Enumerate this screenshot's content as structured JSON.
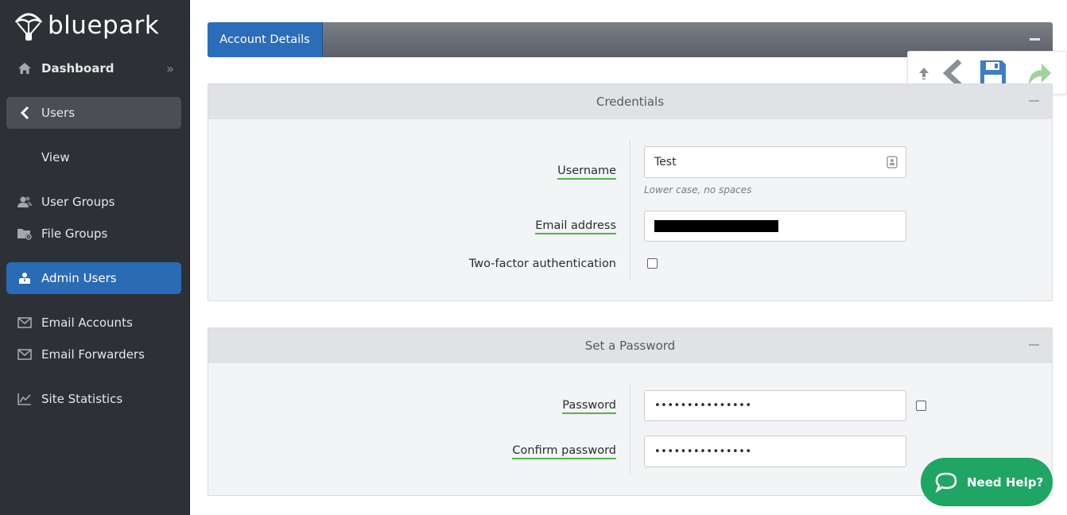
{
  "brand": {
    "name": "bluepark"
  },
  "sidebar": {
    "items": [
      {
        "label": "Dashboard",
        "icon": "home-icon"
      },
      {
        "label": "Users",
        "icon": "chevron-left-icon"
      },
      {
        "label": "View",
        "icon": ""
      },
      {
        "label": "User Groups",
        "icon": "user-group-icon"
      },
      {
        "label": "File Groups",
        "icon": "folder-settings-icon"
      },
      {
        "label": "Admin Users",
        "icon": "admin-user-icon"
      },
      {
        "label": "Email Accounts",
        "icon": "envelope-icon"
      },
      {
        "label": "Email Forwarders",
        "icon": "envelope-icon"
      },
      {
        "label": "Site Statistics",
        "icon": "line-chart-icon"
      }
    ],
    "dashboard_chevron": "››"
  },
  "tabs": [
    {
      "label": "Account Details",
      "active": true
    }
  ],
  "toolbar": {
    "buttons": [
      "upload-icon",
      "back-icon",
      "save-icon",
      "forward-icon"
    ],
    "colors": {
      "save": "#3d7ec7",
      "forward": "#9fd39c",
      "back": "#8b9096"
    }
  },
  "credentials": {
    "title": "Credentials",
    "username_label": "Username",
    "username_value": "Test",
    "username_hint": "Lower case, no spaces",
    "email_label": "Email address",
    "email_value": "",
    "twofa_label": "Two-factor authentication"
  },
  "password": {
    "title": "Set a Password",
    "password_label": "Password",
    "password_value": "•••••••••••••••",
    "confirm_label": "Confirm password",
    "confirm_value": "•••••••••••••••"
  },
  "help": {
    "label": "Need Help?"
  },
  "colors": {
    "accent": "#2c6db9",
    "sidebar": "#2d3034",
    "underline": "#4cb848",
    "help": "#1fa564"
  }
}
